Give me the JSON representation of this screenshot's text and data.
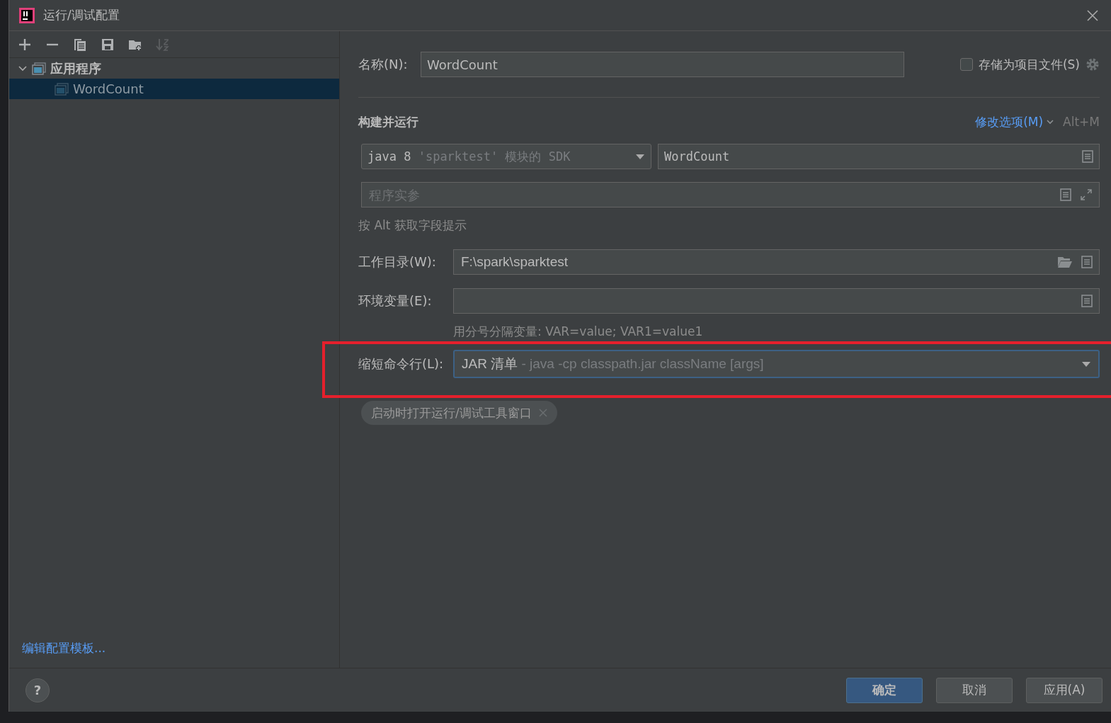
{
  "window": {
    "title": "运行/调试配置"
  },
  "toolbar": [
    {
      "kind": "add",
      "disabled": false
    },
    {
      "kind": "remove",
      "disabled": false
    },
    {
      "kind": "copy",
      "disabled": false
    },
    {
      "kind": "save",
      "disabled": false
    },
    {
      "kind": "folder",
      "disabled": false
    },
    {
      "kind": "sort",
      "disabled": true
    }
  ],
  "tree": [
    {
      "label": "应用程序",
      "expanded": true,
      "selected": false,
      "children": [
        {
          "label": "WordCount",
          "selected": true
        }
      ]
    }
  ],
  "edit_templates_link": "编辑配置模板...",
  "name_field": {
    "label": "名称(N):",
    "value": "WordCount"
  },
  "store_as_project_file": {
    "label": "存储为项目文件(S)",
    "checked": false
  },
  "section": {
    "title": "构建并运行",
    "modify_options": "修改选项(M)",
    "shortcut": "Alt+M"
  },
  "jdk_select": {
    "value": "java 8",
    "hint": "'sparktest' 模块的 SDK"
  },
  "main_class_field": {
    "value": "WordCount"
  },
  "program_args_field": {
    "placeholder": "程序实参"
  },
  "alt_hint": "按 Alt 获取字段提示",
  "working_dir": {
    "label": "工作目录(W):",
    "value": "F:\\spark\\sparktest"
  },
  "env_vars": {
    "label": "环境变量(E):",
    "hint": "用分号分隔变量: VAR=value; VAR1=value1"
  },
  "shorten_cmd": {
    "label": "缩短命令行(L):",
    "value": "JAR 清单",
    "hint": "- java -cp classpath.jar className [args]",
    "focused": true
  },
  "option_tags": [
    {
      "label": "启动时打开运行/调试工具窗口"
    }
  ],
  "help_button": "?",
  "buttons": [
    {
      "label": "确定",
      "kind": "primary"
    },
    {
      "label": "取消",
      "kind": "normal"
    },
    {
      "label": "应用(A)",
      "kind": "normal"
    }
  ]
}
